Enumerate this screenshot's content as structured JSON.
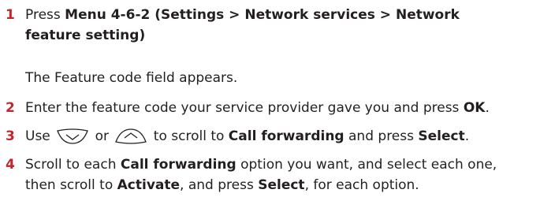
{
  "steps": [
    {
      "number": "1",
      "line1_prefix": "Press ",
      "line1_bold": "Menu 4-6-2 (Settings > Network services > Network",
      "line2_bold": "feature setting",
      "line2_suffix": ")",
      "note": "The Feature code field appears."
    },
    {
      "number": "2",
      "text_prefix": "Enter the feature code your service provider gave you and press ",
      "text_bold": "OK",
      "text_suffix": "."
    },
    {
      "number": "3",
      "use": "Use",
      "or": "or",
      "to_scroll": "to scroll to ",
      "bold1": "Call forwarding",
      "and_press": " and press ",
      "bold2": "Select",
      "period": ".",
      "icons": [
        "scroll-down-key-icon",
        "scroll-up-key-icon"
      ]
    },
    {
      "number": "4",
      "line1_prefix": "Scroll to each ",
      "line1_bold": "Call forwarding",
      "line1_suffix": " option you want, and select each one,",
      "line2_prefix": "then scroll to ",
      "line2_bold1": "Activate",
      "line2_mid": ", and press ",
      "line2_bold2": "Select",
      "line2_suffix": ", for each option."
    }
  ],
  "colors": {
    "step_number": "#c1262e",
    "text": "#231f20"
  }
}
